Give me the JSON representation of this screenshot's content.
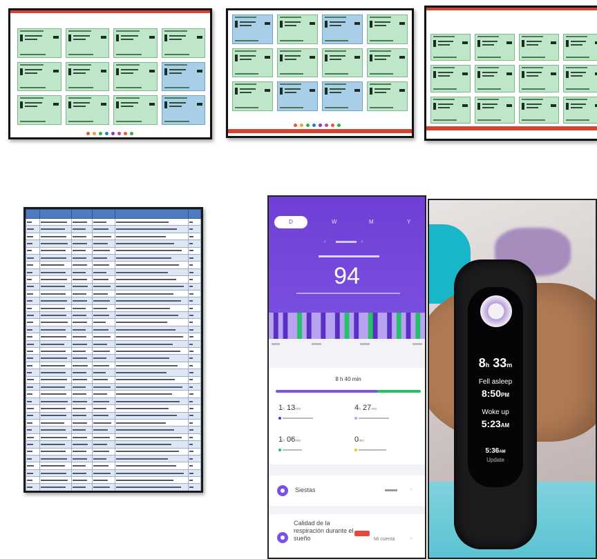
{
  "dashboards": [
    {
      "cards": [
        "g",
        "g",
        "g",
        "g",
        "g",
        "g",
        "g",
        "b",
        "g",
        "g",
        "g",
        "b"
      ],
      "footer": "bottom"
    },
    {
      "cards": [
        "b",
        "g",
        "b",
        "g",
        "g",
        "g",
        "g",
        "g",
        "g",
        "b",
        "b",
        "g"
      ],
      "footer": "bottom"
    },
    {
      "cards": [
        "g",
        "g",
        "g",
        "g",
        "g",
        "g",
        "g",
        "g",
        "g",
        "g",
        "g",
        "g"
      ],
      "footer": "bottom"
    }
  ],
  "dot_colors": [
    "#e05a3a",
    "#f0a030",
    "#38a846",
    "#2a7bd0",
    "#7a3fc0",
    "#d0408a",
    "#e05a3a",
    "#38a846"
  ],
  "table": {
    "rows": 43
  },
  "phone": {
    "tabs": [
      "D",
      "W",
      "M",
      "Y"
    ],
    "score": "94",
    "total": "8 h 40 min",
    "colors": {
      "purple": "#7b52e0",
      "deep": "#5a2fc4",
      "light": "#b8a2f2",
      "green": "#26c06a"
    },
    "stats": [
      {
        "value": "1",
        "unit": "h",
        "value2": "13",
        "unit2": "min",
        "color": "#5a2fc4"
      },
      {
        "value": "4",
        "unit": "h",
        "value2": "27",
        "unit2": "min",
        "color": "#b8a2f2"
      },
      {
        "value": "1",
        "unit": "h",
        "value2": "06",
        "unit2": "min",
        "color": "#26c06a"
      },
      {
        "value": "0",
        "unit": "min",
        "value2": "",
        "unit2": "",
        "color": "#f5c518"
      }
    ],
    "naps": {
      "label": "Siestas"
    },
    "breathing": {
      "label": "Calidad de la respiración durante el sueño",
      "value": "Mi cuenta"
    }
  },
  "band": {
    "time_h": "8",
    "time_m": "33",
    "fell_asleep_label": "Fell asleep",
    "fell_asleep_time": "8:50",
    "fell_asleep_ampm": "PM",
    "woke_label": "Woke up",
    "woke_time": "5:23",
    "woke_ampm": "AM",
    "update_time": "5:36",
    "update_ampm": "AM",
    "update_label": "Update"
  }
}
